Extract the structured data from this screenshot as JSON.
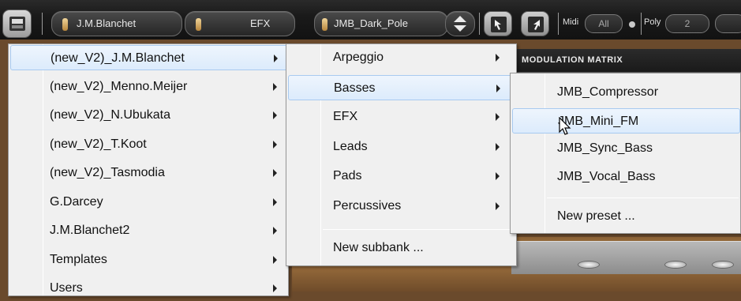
{
  "toolbar": {
    "bank_name": "J.M.Blanchet",
    "category": "EFX",
    "preset_name": "JMB_Dark_Pole",
    "midi_label": "Midi",
    "midi_channel": "All",
    "poly_label": "Poly",
    "poly_value": "2"
  },
  "panel": {
    "modulation_header": "MODULATION MATRIX"
  },
  "menu_banks": {
    "items": [
      {
        "label": "(new_V2)_J.M.Blanchet",
        "submenu": true,
        "highlighted": true
      },
      {
        "label": "(new_V2)_Menno.Meijer",
        "submenu": true
      },
      {
        "label": "(new_V2)_N.Ubukata",
        "submenu": true
      },
      {
        "label": "(new_V2)_T.Koot",
        "submenu": true
      },
      {
        "label": "(new_V2)_Tasmodia",
        "submenu": true
      },
      {
        "label": "G.Darcey",
        "submenu": true
      },
      {
        "label": "J.M.Blanchet2",
        "submenu": true
      },
      {
        "label": "Templates",
        "submenu": true
      },
      {
        "label": "Users",
        "submenu": true
      }
    ]
  },
  "menu_subbanks": {
    "items": [
      {
        "label": "Arpeggio",
        "submenu": true
      },
      {
        "label": "Basses",
        "submenu": true,
        "highlighted": true
      },
      {
        "label": "EFX",
        "submenu": true
      },
      {
        "label": "Leads",
        "submenu": true
      },
      {
        "label": "Pads",
        "submenu": true
      },
      {
        "label": "Percussives",
        "submenu": true
      }
    ],
    "new_subbank": "New subbank ..."
  },
  "menu_presets": {
    "items": [
      {
        "label": "JMB_Compressor"
      },
      {
        "label": "JMB_Mini_FM",
        "highlighted": true
      },
      {
        "label": "JMB_Sync_Bass"
      },
      {
        "label": "JMB_Vocal_Bass"
      }
    ],
    "new_preset": "New preset ..."
  },
  "colors": {
    "toolbar_bg": "#1a1a1a",
    "menu_bg": "#f0f0f0",
    "highlight": "#dcebfc",
    "gold_led": "#d4a65a"
  }
}
